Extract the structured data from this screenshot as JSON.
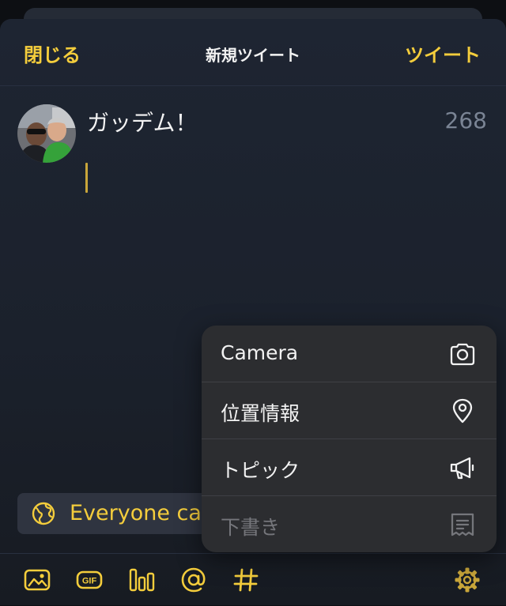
{
  "nav": {
    "close_label": "閉じる",
    "title": "新規ツイート",
    "tweet_label": "ツイート"
  },
  "composer": {
    "text": "ガッデム！",
    "remaining_chars": "268"
  },
  "audience": {
    "label": "Everyone ca",
    "icon": "globe-icon"
  },
  "toolbar": {
    "icons": [
      "image-icon",
      "gif-icon",
      "poll-icon",
      "mention-icon",
      "hashtag-icon",
      "settings-icon"
    ]
  },
  "menu": {
    "items": [
      {
        "label": "Camera",
        "icon": "camera-icon",
        "enabled": true
      },
      {
        "label": "位置情報",
        "icon": "location-pin-icon",
        "enabled": true
      },
      {
        "label": "トピック",
        "icon": "megaphone-icon",
        "enabled": true
      },
      {
        "label": "下書き",
        "icon": "drafts-icon",
        "enabled": false
      }
    ]
  },
  "colors": {
    "accent": "#f4cd3c",
    "background": "#1e2532",
    "menu_background": "#2c2d30",
    "muted_text": "#7a8494"
  }
}
